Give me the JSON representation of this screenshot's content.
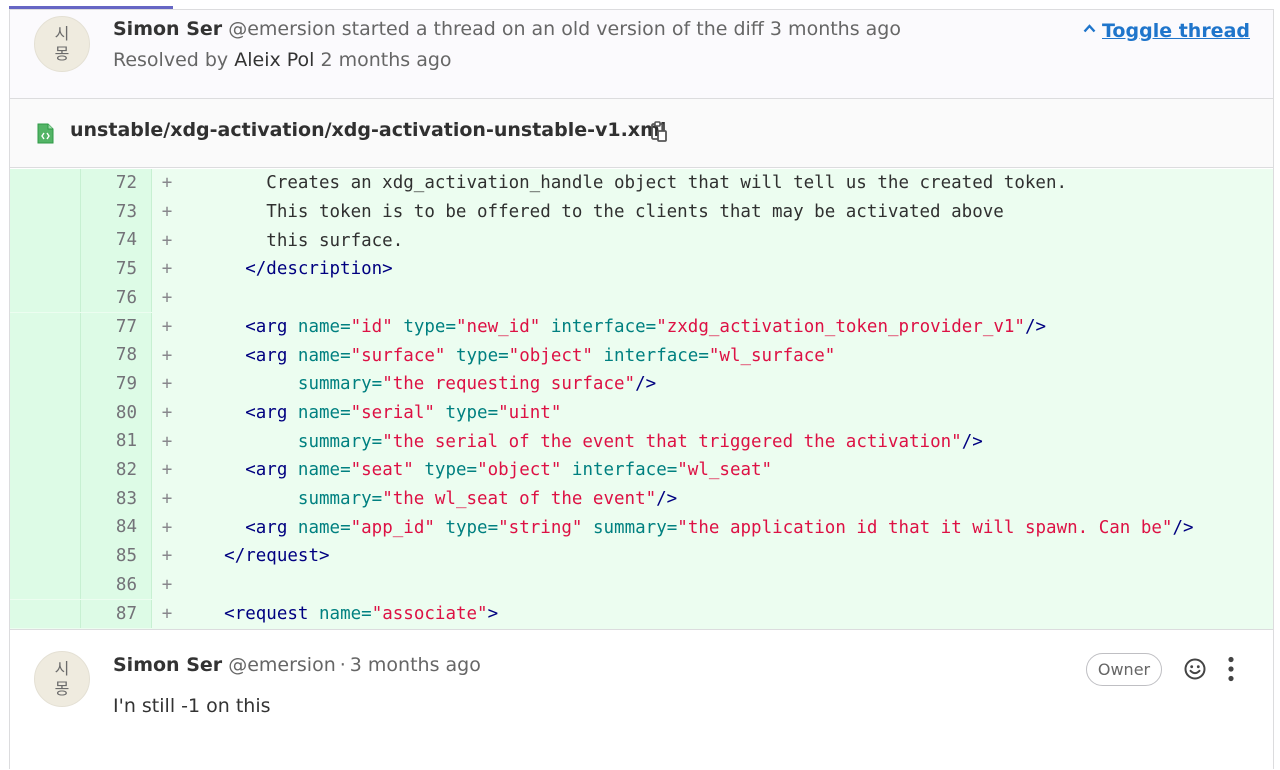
{
  "thread": {
    "avatar_chars": [
      "시",
      "몽"
    ],
    "author_name": "Simon Ser",
    "author_handle": "@emersion",
    "action_text": "started a thread on an old version of the diff 3 months ago",
    "resolved_prefix": "Resolved by",
    "resolved_by": "Aleix Pol",
    "resolved_time": "2 months ago",
    "toggle_label": "Toggle thread"
  },
  "file": {
    "path": "unstable/xdg-activation/xdg-activation-unstable-v1.xml",
    "icon": "file-code-icon",
    "copy_icon": "copy-to-clipboard-icon"
  },
  "diff": {
    "lines": [
      {
        "num": "72",
        "sign": "+",
        "tokens": [
          {
            "t": "plain",
            "v": "        Creates an xdg_activation_handle object that will tell us the created token."
          }
        ]
      },
      {
        "num": "73",
        "sign": "+",
        "tokens": [
          {
            "t": "plain",
            "v": "        This token is to be offered to the clients that may be activated above"
          }
        ]
      },
      {
        "num": "74",
        "sign": "+",
        "tokens": [
          {
            "t": "plain",
            "v": "        this surface."
          }
        ]
      },
      {
        "num": "75",
        "sign": "+",
        "tokens": [
          {
            "t": "plain",
            "v": "      "
          },
          {
            "t": "tag",
            "v": "</description>"
          }
        ]
      },
      {
        "num": "76",
        "sign": "+",
        "tokens": [
          {
            "t": "plain",
            "v": ""
          }
        ]
      },
      {
        "num": "77",
        "sign": "+",
        "tokens": [
          {
            "t": "plain",
            "v": "      "
          },
          {
            "t": "tag",
            "v": "<arg"
          },
          {
            "t": "plain",
            "v": " "
          },
          {
            "t": "attr",
            "v": "name="
          },
          {
            "t": "str",
            "v": "\"id\""
          },
          {
            "t": "plain",
            "v": " "
          },
          {
            "t": "attr",
            "v": "type="
          },
          {
            "t": "str",
            "v": "\"new_id\""
          },
          {
            "t": "plain",
            "v": " "
          },
          {
            "t": "attr",
            "v": "interface="
          },
          {
            "t": "str",
            "v": "\"zxdg_activation_token_provider_v1\""
          },
          {
            "t": "tag",
            "v": "/>"
          }
        ]
      },
      {
        "num": "78",
        "sign": "+",
        "tokens": [
          {
            "t": "plain",
            "v": "      "
          },
          {
            "t": "tag",
            "v": "<arg"
          },
          {
            "t": "plain",
            "v": " "
          },
          {
            "t": "attr",
            "v": "name="
          },
          {
            "t": "str",
            "v": "\"surface\""
          },
          {
            "t": "plain",
            "v": " "
          },
          {
            "t": "attr",
            "v": "type="
          },
          {
            "t": "str",
            "v": "\"object\""
          },
          {
            "t": "plain",
            "v": " "
          },
          {
            "t": "attr",
            "v": "interface="
          },
          {
            "t": "str",
            "v": "\"wl_surface\""
          }
        ]
      },
      {
        "num": "79",
        "sign": "+",
        "tokens": [
          {
            "t": "plain",
            "v": "           "
          },
          {
            "t": "attr",
            "v": "summary="
          },
          {
            "t": "str",
            "v": "\"the requesting surface\""
          },
          {
            "t": "tag",
            "v": "/>"
          }
        ]
      },
      {
        "num": "80",
        "sign": "+",
        "tokens": [
          {
            "t": "plain",
            "v": "      "
          },
          {
            "t": "tag",
            "v": "<arg"
          },
          {
            "t": "plain",
            "v": " "
          },
          {
            "t": "attr",
            "v": "name="
          },
          {
            "t": "str",
            "v": "\"serial\""
          },
          {
            "t": "plain",
            "v": " "
          },
          {
            "t": "attr",
            "v": "type="
          },
          {
            "t": "str",
            "v": "\"uint\""
          }
        ]
      },
      {
        "num": "81",
        "sign": "+",
        "tokens": [
          {
            "t": "plain",
            "v": "           "
          },
          {
            "t": "attr",
            "v": "summary="
          },
          {
            "t": "str",
            "v": "\"the serial of the event that triggered the activation\""
          },
          {
            "t": "tag",
            "v": "/>"
          }
        ]
      },
      {
        "num": "82",
        "sign": "+",
        "tokens": [
          {
            "t": "plain",
            "v": "      "
          },
          {
            "t": "tag",
            "v": "<arg"
          },
          {
            "t": "plain",
            "v": " "
          },
          {
            "t": "attr",
            "v": "name="
          },
          {
            "t": "str",
            "v": "\"seat\""
          },
          {
            "t": "plain",
            "v": " "
          },
          {
            "t": "attr",
            "v": "type="
          },
          {
            "t": "str",
            "v": "\"object\""
          },
          {
            "t": "plain",
            "v": " "
          },
          {
            "t": "attr",
            "v": "interface="
          },
          {
            "t": "str",
            "v": "\"wl_seat\""
          }
        ]
      },
      {
        "num": "83",
        "sign": "+",
        "tokens": [
          {
            "t": "plain",
            "v": "           "
          },
          {
            "t": "attr",
            "v": "summary="
          },
          {
            "t": "str",
            "v": "\"the wl_seat of the event\""
          },
          {
            "t": "tag",
            "v": "/>"
          }
        ]
      },
      {
        "num": "84",
        "sign": "+",
        "tokens": [
          {
            "t": "plain",
            "v": "      "
          },
          {
            "t": "tag",
            "v": "<arg"
          },
          {
            "t": "plain",
            "v": " "
          },
          {
            "t": "attr",
            "v": "name="
          },
          {
            "t": "str",
            "v": "\"app_id\""
          },
          {
            "t": "plain",
            "v": " "
          },
          {
            "t": "attr",
            "v": "type="
          },
          {
            "t": "str",
            "v": "\"string\""
          },
          {
            "t": "plain",
            "v": " "
          },
          {
            "t": "attr",
            "v": "summary="
          },
          {
            "t": "str",
            "v": "\"the application id that it will spawn. Can be\""
          },
          {
            "t": "tag",
            "v": "/>"
          }
        ]
      },
      {
        "num": "85",
        "sign": "+",
        "tokens": [
          {
            "t": "plain",
            "v": "    "
          },
          {
            "t": "tag",
            "v": "</request>"
          }
        ]
      },
      {
        "num": "86",
        "sign": "+",
        "tokens": [
          {
            "t": "plain",
            "v": ""
          }
        ]
      },
      {
        "num": "87",
        "sign": "+",
        "tokens": [
          {
            "t": "plain",
            "v": "    "
          },
          {
            "t": "tag",
            "v": "<request"
          },
          {
            "t": "plain",
            "v": " "
          },
          {
            "t": "attr",
            "v": "name="
          },
          {
            "t": "str",
            "v": "\"associate\""
          },
          {
            "t": "tag",
            "v": ">"
          }
        ]
      }
    ]
  },
  "comment": {
    "avatar_chars": [
      "시",
      "몽"
    ],
    "author_name": "Simon Ser",
    "author_handle": "@emersion",
    "separator": "·",
    "time": "3 months ago",
    "badge": "Owner",
    "body": "I'n still -1 on this",
    "reaction_icon": "smiley-icon",
    "menu_icon": "kebab-menu-icon"
  },
  "colors": {
    "link": "#1f75cb",
    "diff_added_bg": "#ecfdf0",
    "diff_gutter_bg": "#ddfbe6",
    "tag": "#000080",
    "attr": "#008080",
    "string": "#dd1144",
    "accent": "#6666c4"
  }
}
